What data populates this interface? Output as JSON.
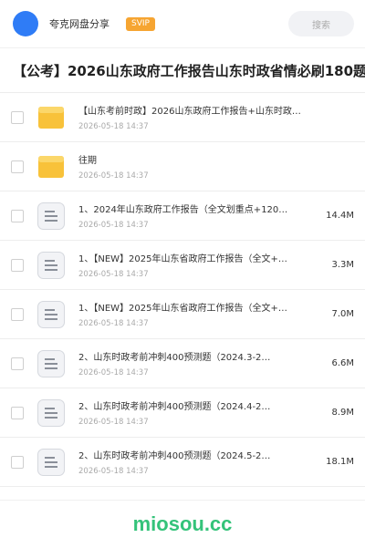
{
  "header": {
    "brand": "夸克网盘分享",
    "badge": "SVIP",
    "search_label": "搜索"
  },
  "page": {
    "title": "【公考】2026山东政府工作报告山东时政省情必刷180题"
  },
  "files": [
    {
      "type": "folder",
      "name": "【山东考前时政】2026山东政府工作报告+山东时政…",
      "date": "2026-05-18 14:37",
      "size": ""
    },
    {
      "type": "folder",
      "name": "往期",
      "date": "2026-05-18 14:37",
      "size": ""
    },
    {
      "type": "doc",
      "name": "1、2024年山东政府工作报告（全文划重点+120…",
      "date": "2026-05-18 14:37",
      "size": "14.4M"
    },
    {
      "type": "doc",
      "name": "1、【NEW】2025年山东省政府工作报告（全文+…",
      "date": "2026-05-18 14:37",
      "size": "3.3M"
    },
    {
      "type": "doc",
      "name": "1、【NEW】2025年山东省政府工作报告（全文+…",
      "date": "2026-05-18 14:37",
      "size": "7.0M"
    },
    {
      "type": "doc",
      "name": "2、山东时政考前冲刺400预测题（2024.3-2…",
      "date": "2026-05-18 14:37",
      "size": "6.6M"
    },
    {
      "type": "doc",
      "name": "2、山东时政考前冲刺400预测题（2024.4-2…",
      "date": "2026-05-18 14:37",
      "size": "8.9M"
    },
    {
      "type": "doc",
      "name": "2、山东时政考前冲刺400预测题（2024.5-2…",
      "date": "2026-05-18 14:37",
      "size": "18.1M"
    }
  ],
  "footer": {
    "watermark": "miosou.cc"
  },
  "colors": {
    "accent": "#2f7cf6",
    "badge": "#f6a532",
    "folder": "#f8c23a",
    "watermark": "#34c37a"
  }
}
